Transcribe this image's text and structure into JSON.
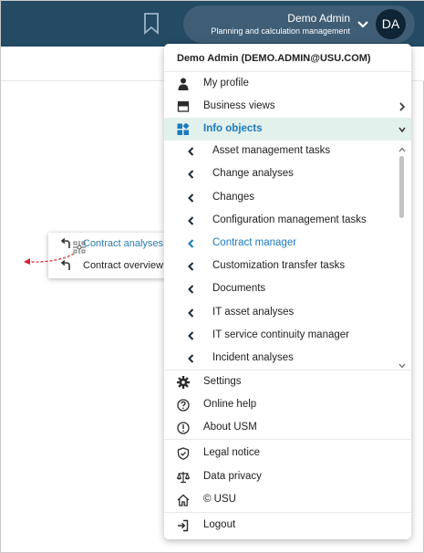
{
  "topbar": {
    "user_name": "Demo Admin",
    "user_role": "Planning and calculation management",
    "avatar_initials": "DA",
    "background": "#244a64"
  },
  "drag_popup": {
    "items": [
      {
        "label": "Contract analyses",
        "icon": "return-arrow-icon",
        "active": true
      },
      {
        "label": "Contract overview",
        "icon": "return-arrow-icon",
        "active": false
      }
    ]
  },
  "menu": {
    "header": "Demo Admin (DEMO.ADMIN@USU.COM)",
    "top_items": [
      {
        "label": "My profile",
        "icon": "person-icon"
      },
      {
        "label": "Business views",
        "icon": "window-stack-icon",
        "has_submenu": true
      },
      {
        "label": "Info objects",
        "icon": "apps-blocks-icon",
        "expanded": true
      }
    ],
    "info_object_items": [
      {
        "label": "Asset management tasks"
      },
      {
        "label": "Change analyses"
      },
      {
        "label": "Changes"
      },
      {
        "label": "Configuration management tasks"
      },
      {
        "label": "Contract manager",
        "current": true
      },
      {
        "label": "Customization transfer tasks"
      },
      {
        "label": "Documents"
      },
      {
        "label": "IT asset analyses"
      },
      {
        "label": "IT service continuity manager"
      },
      {
        "label": "Incident analyses"
      }
    ],
    "bottom_group_1": [
      {
        "label": "Settings",
        "icon": "gear-icon"
      },
      {
        "label": "Online help",
        "icon": "help-circle-icon"
      },
      {
        "label": "About USM",
        "icon": "info-circle-icon"
      }
    ],
    "bottom_group_2": [
      {
        "label": "Legal notice",
        "icon": "shield-check-icon"
      },
      {
        "label": "Data privacy",
        "icon": "scale-icon"
      },
      {
        "label": "© USU",
        "icon": "home-icon"
      }
    ],
    "logout": {
      "label": "Logout",
      "icon": "logout-icon"
    },
    "accent": "#1a7abf",
    "active_bg": "#e3f1ed"
  }
}
